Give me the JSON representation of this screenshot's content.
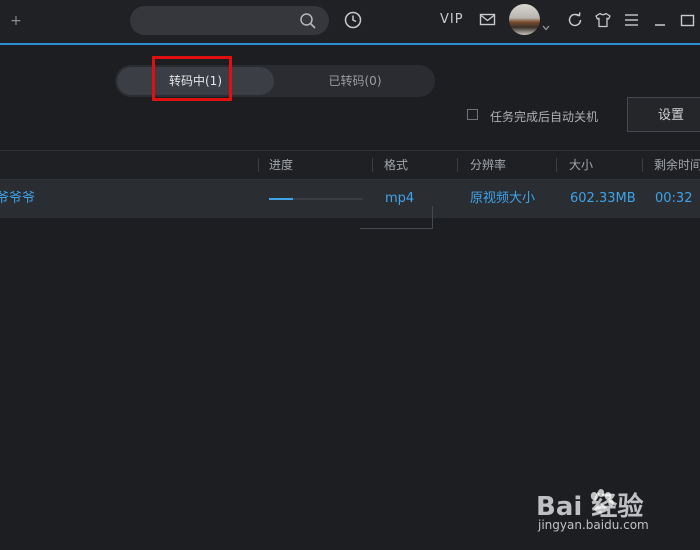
{
  "titlebar": {
    "add_icon": "plus-icon",
    "search": {
      "value": "",
      "placeholder": ""
    },
    "vip_label": "VIP",
    "icons": [
      "search-icon",
      "clock-icon",
      "mail-icon",
      "refresh-icon",
      "shirt-icon",
      "menu-icon",
      "minimize-icon",
      "maximize-icon"
    ],
    "accent_color": "#2a8fd6"
  },
  "tabs": [
    {
      "label": "转码中(1)",
      "active": true
    },
    {
      "label": "已转码(0)",
      "active": false
    }
  ],
  "options": {
    "left_fragment": "：",
    "auto_shutdown_label": "任务完成后自动关机",
    "auto_shutdown_checked": false,
    "settings_label": "设置"
  },
  "table": {
    "columns": [
      "进度",
      "格式",
      "分辨率",
      "大小",
      "剩余时间"
    ],
    "rows": [
      {
        "name": "爷爷爷",
        "progress": 0.25,
        "format": "mp4",
        "resolution": "原视频大小",
        "size": "602.33MB",
        "remaining": "00:32"
      }
    ]
  },
  "watermark": {
    "logo_text": "Bai  经验",
    "site": "jingyan.baidu.com"
  }
}
